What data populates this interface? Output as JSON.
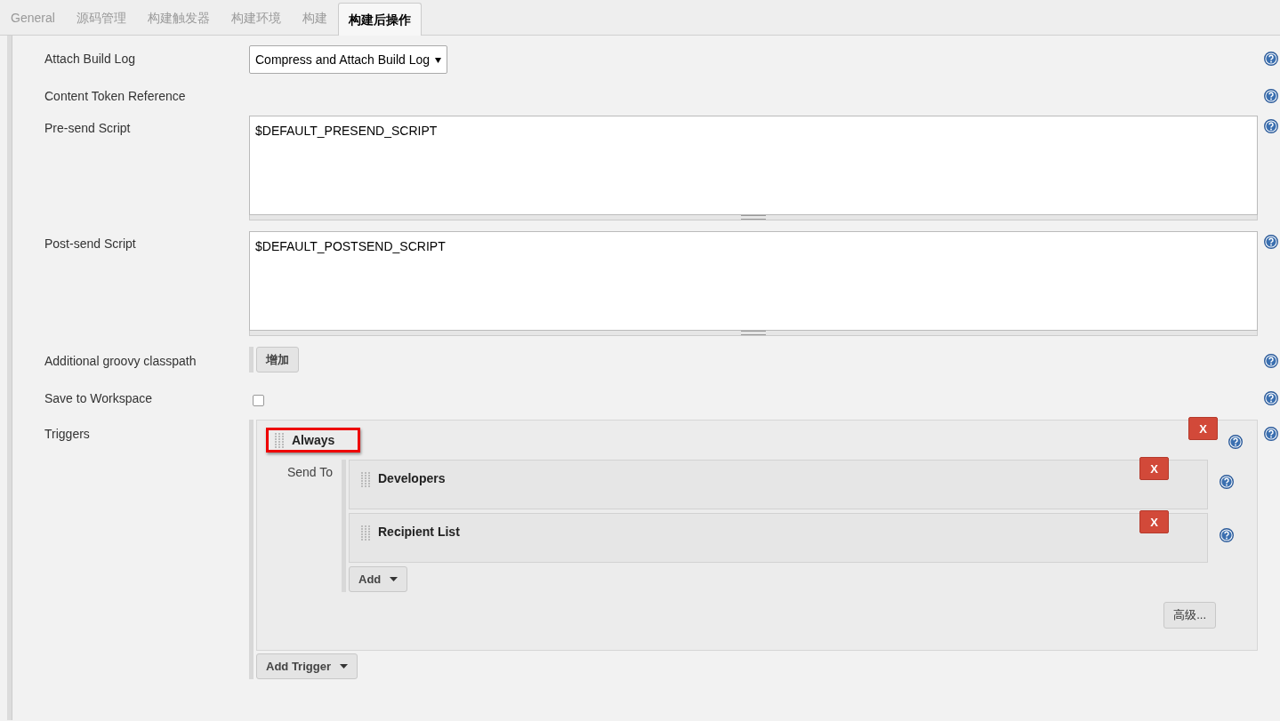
{
  "tabs": [
    {
      "label": "General",
      "selected": false
    },
    {
      "label": "源码管理",
      "selected": false
    },
    {
      "label": "构建触发器",
      "selected": false
    },
    {
      "label": "构建环境",
      "selected": false
    },
    {
      "label": "构建",
      "selected": false
    },
    {
      "label": "构建后操作",
      "selected": true
    }
  ],
  "fields": [
    {
      "kind": "select",
      "label": "Attach Build Log",
      "value": "Compress and Attach Build Log"
    },
    {
      "kind": "text",
      "label": "Content Token Reference"
    },
    {
      "kind": "textarea",
      "label": "Pre-send Script",
      "value": "$DEFAULT_PRESEND_SCRIPT"
    },
    {
      "kind": "textarea",
      "label": "Post-send Script",
      "value": "$DEFAULT_POSTSEND_SCRIPT"
    },
    {
      "kind": "button",
      "label": "Additional groovy classpath",
      "button": "增加"
    },
    {
      "kind": "checkbox",
      "label": "Save to Workspace",
      "checked": false
    }
  ],
  "triggers": {
    "label": "Triggers",
    "items": [
      {
        "name": "Always",
        "highlighted": true,
        "delete": "X",
        "send_to_label": "Send To",
        "recipients": [
          {
            "name": "Developers",
            "delete": "X"
          },
          {
            "name": "Recipient List",
            "delete": "X"
          }
        ],
        "add_button": "Add",
        "advanced_button": "高级..."
      }
    ],
    "add_trigger": "Add Trigger"
  }
}
